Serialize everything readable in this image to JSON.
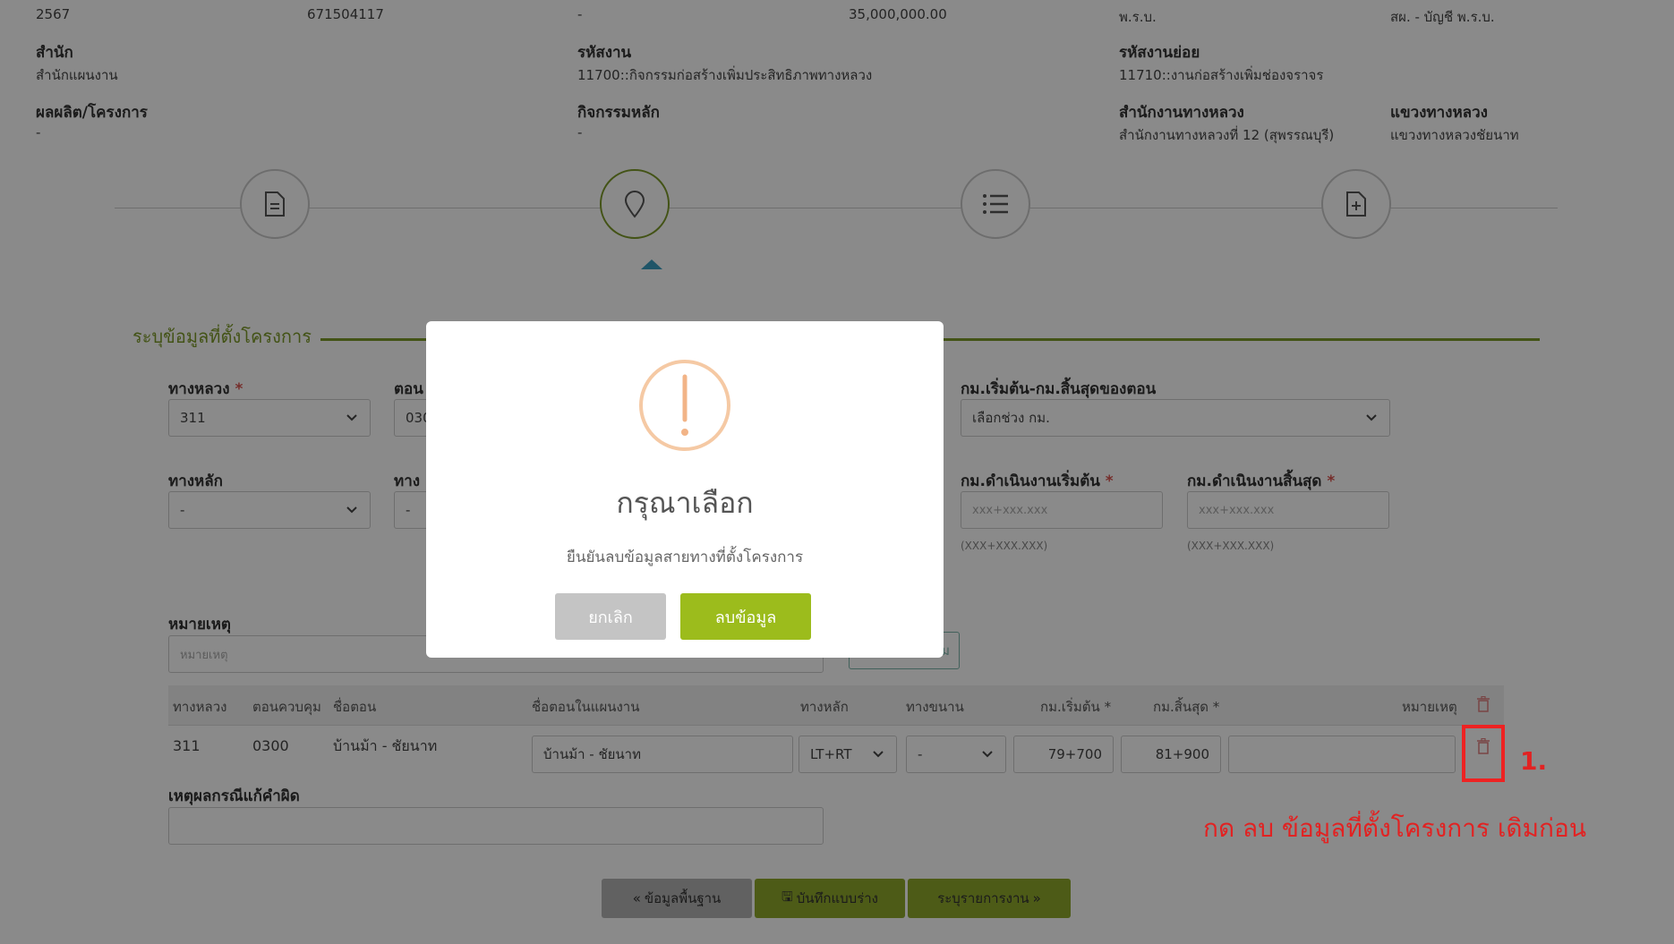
{
  "top_row": {
    "year": "2567",
    "code": "671504117",
    "dash": "-",
    "amount": "35,000,000.00",
    "pr_label": "พ.ร.บ.",
    "budget_type": "สผ. - บัญชี พ.ร.บ."
  },
  "info": {
    "office_label": "สำนัก",
    "office_value": "สำนักแผนงาน",
    "work_code_label": "รหัสงาน",
    "work_code_value": "11700::กิจกรรมก่อสร้างเพิ่มประสิทธิภาพทางหลวง",
    "sub_code_label": "รหัสงานย่อย",
    "sub_code_value": "11710::งานก่อสร้างเพิ่มช่องจราจร",
    "product_label": "ผลผลิต/โครงการ",
    "product_value": "-",
    "activity_label": "กิจกรรมหลัก",
    "activity_value": "-",
    "highway_office_label": "สำนักงานทางหลวง",
    "highway_office_value": "สำนักงานทางหลวงที่ 12 (สุพรรณบุรี)",
    "district_label": "แขวงทางหลวง",
    "district_value": "แขวงทางหลวงชัยนาท"
  },
  "section_title": "ระบุข้อมูลที่ตั้งโครงการ",
  "form": {
    "highway_label": "ทางหลวง",
    "highway_value": "311",
    "section_label": "ตอน",
    "section_value": "030",
    "km_range_label": "กม.เริ่มต้น-กม.สิ้นสุดของตอน",
    "km_range_value": "เลือกช่วง กม.",
    "main_road_label": "ทางหลัก",
    "main_road_value": "-",
    "frontage_label": "ทาง",
    "frontage_value": "-",
    "km_start_label": "กม.ดำเนินงานเริ่มต้น",
    "km_start_placeholder": "xxx+xxx.xxx",
    "km_start_hint": "(XXX+XXX.XXX)",
    "km_end_label": "กม.ดำเนินงานสิ้นสุด",
    "km_end_placeholder": "xxx+xxx.xxx",
    "km_end_hint": "(XXX+XXX.XXX)",
    "remark_label": "หมายเหตุ",
    "remark_placeholder": "หมายเหตุ",
    "add_button_partial": "ม"
  },
  "table": {
    "headers": [
      "ทางหลวง",
      "ตอนควบคุม",
      "ชื่อตอน",
      "ชื่อตอนในแผนงาน",
      "ทางหลัก",
      "ทางขนาน",
      "กม.เริ่มต้น *",
      "กม.สิ้นสุด *",
      "หมายเหตุ"
    ],
    "row": {
      "highway": "311",
      "control": "0300",
      "name": "บ้านม้า - ชัยนาท",
      "plan_name": "บ้านม้า - ชัยนาท",
      "main": "LT+RT",
      "parallel": "-",
      "km_start": "79+700",
      "km_end": "81+900",
      "remark": ""
    }
  },
  "correction_label": "เหตุผลกรณีแก้คำผิด",
  "footer": {
    "back": "ข้อมูลพื้นฐาน",
    "save_draft": "บันทึกแบบร่าง",
    "next": "ระบุรายการงาน"
  },
  "annotation": {
    "number": "1.",
    "text": "กด ลบ ข้อมูลที่ตั้งโครงการ เดิมก่อน",
    "color": "#e22222"
  },
  "modal": {
    "title": "กรุณาเลือก",
    "message": "ยืนยันลบข้อมูลสายทางที่ตั้งโครงการ",
    "cancel": "ยกเลิก",
    "confirm": "ลบข้อมูล",
    "confirm_color": "#9cbc1c",
    "cancel_color": "#c4c4c4",
    "icon": "exclamation-circle-icon"
  },
  "colors": {
    "accent": "#7d9a2a",
    "active_marker": "#3a9ec0"
  }
}
